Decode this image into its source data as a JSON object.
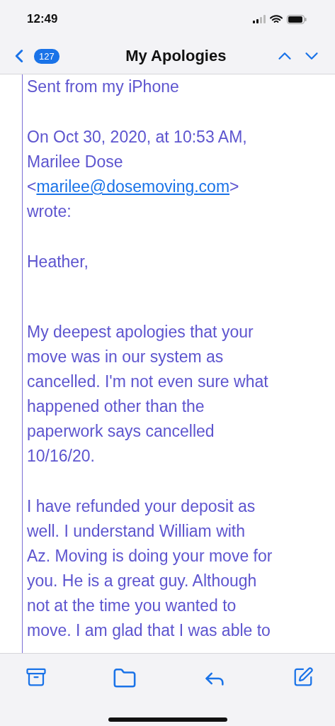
{
  "status_bar": {
    "time": "12:49"
  },
  "nav": {
    "unread_count": "127",
    "title": "My Apologies"
  },
  "message": {
    "signature": "Sent from my iPhone",
    "attribution": {
      "lines": [
        "On Oct 30, 2020, at 10:53 AM,",
        "Marilee Dose"
      ],
      "open": "<",
      "email": "marilee@dosemoving.com",
      "close": ">",
      "after": "wrote:"
    },
    "greeting": "Heather,",
    "paragraphs": [
      [
        "My deepest apologies that your",
        "move was in our system as",
        "cancelled.  I'm not even sure what",
        "happened other than the",
        "paperwork says cancelled",
        "10/16/20."
      ],
      [
        "I have refunded your deposit as",
        "well.  I understand William with",
        "Az. Moving is doing your move for",
        "you.  He is a great guy.  Although",
        "not at the time you wanted to",
        "move. I am glad that I was able to"
      ]
    ]
  }
}
